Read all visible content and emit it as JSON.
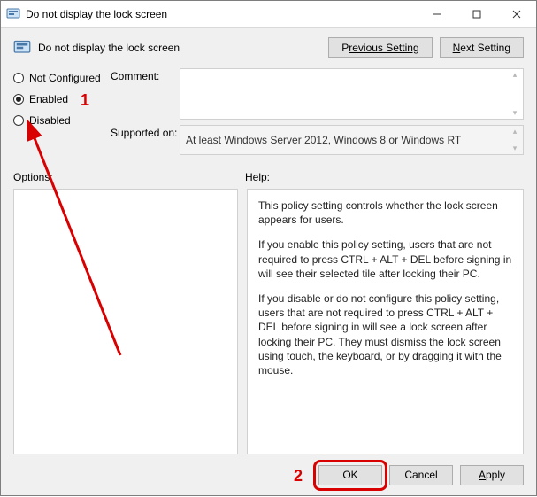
{
  "window": {
    "title": "Do not display the lock screen"
  },
  "header": {
    "title": "Do not display the lock screen",
    "prev_btn_pre": "P",
    "prev_btn_u": "revious Setting",
    "next_btn_u": "N",
    "next_btn_post": "ext Setting"
  },
  "radios": {
    "not_configured": "Not Configured",
    "enabled": "Enabled",
    "disabled": "Disabled",
    "selected": "enabled"
  },
  "meta": {
    "comment_label": "Comment:",
    "comment_value": "",
    "supported_label": "Supported on:",
    "supported_value": "At least Windows Server 2012, Windows 8 or Windows RT"
  },
  "panels": {
    "options_label": "Options:",
    "help_label": "Help:"
  },
  "help": {
    "p1": "This policy setting controls whether the lock screen appears for users.",
    "p2": "If you enable this policy setting, users that are not required to press CTRL + ALT + DEL before signing in will see their selected tile after locking their PC.",
    "p3": "If you disable or do not configure this policy setting, users that are not required to press CTRL + ALT + DEL before signing in will see a lock screen after locking their PC. They must dismiss the lock screen using touch, the keyboard, or by dragging it with the mouse."
  },
  "footer": {
    "ok": "OK",
    "cancel": "Cancel",
    "apply_u": "A",
    "apply_post": "pply"
  },
  "annotations": {
    "n1": "1",
    "n2": "2"
  }
}
